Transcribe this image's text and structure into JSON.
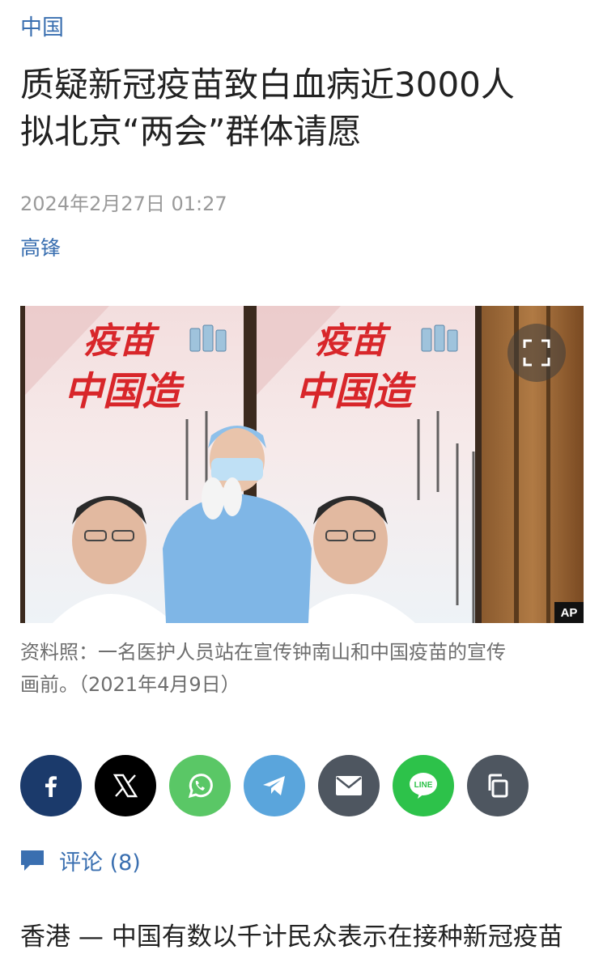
{
  "article": {
    "category": "中国",
    "title_line1": "质疑新冠疫苗致白血病近3000人",
    "title_line2": "拟北京“两会”群体请愿",
    "dateline": "2024年2月27日 01:27",
    "author": "高锋"
  },
  "photo": {
    "poster_text_1": "疫苗",
    "poster_text_2": "中国造",
    "credit_badge": "AP",
    "expand_icon": "expand-icon"
  },
  "caption": {
    "line1": "资料照：一名医护人员站在宣传钟南山和中国疫苗的宣传",
    "line2": "画前。（2021年4月9日）"
  },
  "share": {
    "buttons": [
      {
        "name": "facebook",
        "icon": "facebook-icon",
        "color": "#1b3a6b"
      },
      {
        "name": "x",
        "icon": "x-icon",
        "color": "#000000"
      },
      {
        "name": "whatsapp",
        "icon": "whatsapp-icon",
        "color": "#5ac766"
      },
      {
        "name": "telegram",
        "icon": "telegram-icon",
        "color": "#5aa5dc"
      },
      {
        "name": "email",
        "icon": "envelope-icon",
        "color": "#4e5660"
      },
      {
        "name": "line",
        "icon": "line-icon",
        "color": "#2dc24a",
        "label": "LINE"
      },
      {
        "name": "copy",
        "icon": "copy-icon",
        "color": "#4e5660"
      }
    ]
  },
  "comments": {
    "label": "评论 (8)",
    "icon": "comment-icon"
  },
  "body": {
    "lead": "香港 — 中国有数以千计民众表示在接种新冠疫苗"
  },
  "colors": {
    "link": "#3a6fb0",
    "meta": "#9a9a9a"
  }
}
